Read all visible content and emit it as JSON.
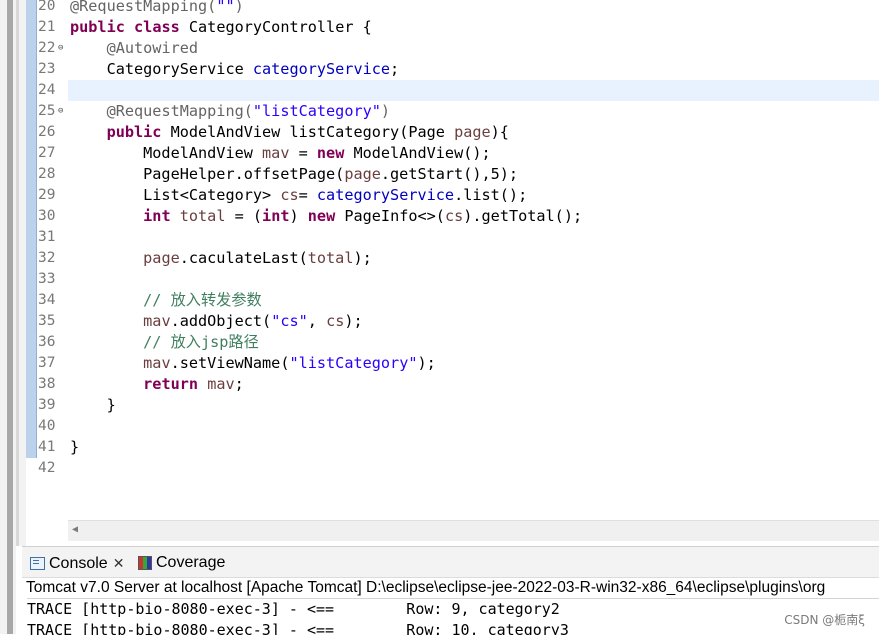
{
  "editor": {
    "lines": [
      {
        "num": "20",
        "fold": "",
        "tokens": [
          {
            "t": "@RequestMapping(",
            "c": "ann"
          },
          {
            "t": "\"\"",
            "c": "str"
          },
          {
            "t": ")",
            "c": "ann"
          }
        ]
      },
      {
        "num": "21",
        "fold": "",
        "tokens": [
          {
            "t": "public",
            "c": "kw"
          },
          {
            "t": " "
          },
          {
            "t": "class",
            "c": "kw"
          },
          {
            "t": " CategoryController {"
          }
        ]
      },
      {
        "num": "22",
        "fold": "⊖",
        "tokens": [
          {
            "t": "    "
          },
          {
            "t": "@Autowired",
            "c": "ann"
          }
        ]
      },
      {
        "num": "23",
        "fold": "",
        "tokens": [
          {
            "t": "    CategoryService "
          },
          {
            "t": "categoryService",
            "c": "fld"
          },
          {
            "t": ";"
          }
        ]
      },
      {
        "num": "24",
        "fold": "",
        "tokens": []
      },
      {
        "num": "25",
        "fold": "⊖",
        "tokens": [
          {
            "t": "    "
          },
          {
            "t": "@RequestMapping(",
            "c": "ann"
          },
          {
            "t": "\"listCategory\"",
            "c": "str"
          },
          {
            "t": ")",
            "c": "ann"
          }
        ]
      },
      {
        "num": "26",
        "fold": "",
        "tokens": [
          {
            "t": "    "
          },
          {
            "t": "public",
            "c": "kw"
          },
          {
            "t": " ModelAndView listCategory(Page "
          },
          {
            "t": "page",
            "c": "loc"
          },
          {
            "t": "){"
          }
        ]
      },
      {
        "num": "27",
        "fold": "",
        "tokens": [
          {
            "t": "        ModelAndView "
          },
          {
            "t": "mav",
            "c": "loc"
          },
          {
            "t": " = "
          },
          {
            "t": "new",
            "c": "kw"
          },
          {
            "t": " ModelAndView();"
          }
        ]
      },
      {
        "num": "28",
        "fold": "",
        "tokens": [
          {
            "t": "        PageHelper.offsetPage("
          },
          {
            "t": "page",
            "c": "loc"
          },
          {
            "t": ".getStart(),5);"
          }
        ]
      },
      {
        "num": "29",
        "fold": "",
        "tokens": [
          {
            "t": "        List<Category> "
          },
          {
            "t": "cs",
            "c": "loc"
          },
          {
            "t": "= "
          },
          {
            "t": "categoryService",
            "c": "fld"
          },
          {
            "t": ".list();"
          }
        ]
      },
      {
        "num": "30",
        "fold": "",
        "tokens": [
          {
            "t": "        "
          },
          {
            "t": "int",
            "c": "kw"
          },
          {
            "t": " "
          },
          {
            "t": "total",
            "c": "loc"
          },
          {
            "t": " = ("
          },
          {
            "t": "int",
            "c": "kw"
          },
          {
            "t": ") "
          },
          {
            "t": "new",
            "c": "kw"
          },
          {
            "t": " PageInfo<>("
          },
          {
            "t": "cs",
            "c": "loc"
          },
          {
            "t": ").getTotal();"
          }
        ]
      },
      {
        "num": "31",
        "fold": "",
        "tokens": []
      },
      {
        "num": "32",
        "fold": "",
        "tokens": [
          {
            "t": "        "
          },
          {
            "t": "page",
            "c": "loc"
          },
          {
            "t": ".caculateLast("
          },
          {
            "t": "total",
            "c": "loc"
          },
          {
            "t": ");"
          }
        ]
      },
      {
        "num": "33",
        "fold": "",
        "tokens": []
      },
      {
        "num": "34",
        "fold": "",
        "tokens": [
          {
            "t": "        "
          },
          {
            "t": "// 放入转发参数",
            "c": "cmt"
          }
        ]
      },
      {
        "num": "35",
        "fold": "",
        "tokens": [
          {
            "t": "        "
          },
          {
            "t": "mav",
            "c": "loc"
          },
          {
            "t": ".addObject("
          },
          {
            "t": "\"cs\"",
            "c": "str"
          },
          {
            "t": ", "
          },
          {
            "t": "cs",
            "c": "loc"
          },
          {
            "t": ");"
          }
        ]
      },
      {
        "num": "36",
        "fold": "",
        "tokens": [
          {
            "t": "        "
          },
          {
            "t": "// 放入jsp路径",
            "c": "cmt"
          }
        ]
      },
      {
        "num": "37",
        "fold": "",
        "tokens": [
          {
            "t": "        "
          },
          {
            "t": "mav",
            "c": "loc"
          },
          {
            "t": ".setViewName("
          },
          {
            "t": "\"listCategory\"",
            "c": "str"
          },
          {
            "t": ");"
          }
        ]
      },
      {
        "num": "38",
        "fold": "",
        "tokens": [
          {
            "t": "        "
          },
          {
            "t": "return",
            "c": "kw"
          },
          {
            "t": " "
          },
          {
            "t": "mav",
            "c": "loc"
          },
          {
            "t": ";"
          }
        ]
      },
      {
        "num": "39",
        "fold": "",
        "tokens": [
          {
            "t": "    }"
          }
        ]
      },
      {
        "num": "40",
        "fold": "",
        "tokens": []
      },
      {
        "num": "41",
        "fold": "",
        "tokens": [
          {
            "t": "}"
          }
        ]
      },
      {
        "num": "42",
        "fold": "",
        "tokens": []
      }
    ]
  },
  "panel": {
    "tabs": [
      {
        "label": "Console",
        "icon": "console-icon",
        "closable": true
      },
      {
        "label": "Coverage",
        "icon": "coverage-icon",
        "closable": false
      }
    ],
    "close_glyph": "✕",
    "launch_text": "Tomcat v7.0 Server at localhost [Apache Tomcat] D:\\eclipse\\eclipse-jee-2022-03-R-win32-x86_64\\eclipse\\plugins\\org",
    "output_lines": [
      "TRACE [http-bio-8080-exec-3] - <==        Row: 9, category2",
      "TRACE [http-bio-8080-exec-3] - <==        Row: 10, category3"
    ]
  },
  "watermark": "CSDN @栀南ξ",
  "colors": {
    "keyword": "#7f0055",
    "string": "#2a00ff",
    "field": "#0000c0",
    "local": "#6a3e3e",
    "annotation": "#646464",
    "comment": "#3f7f5f",
    "current_line": "#e8f2fe"
  }
}
